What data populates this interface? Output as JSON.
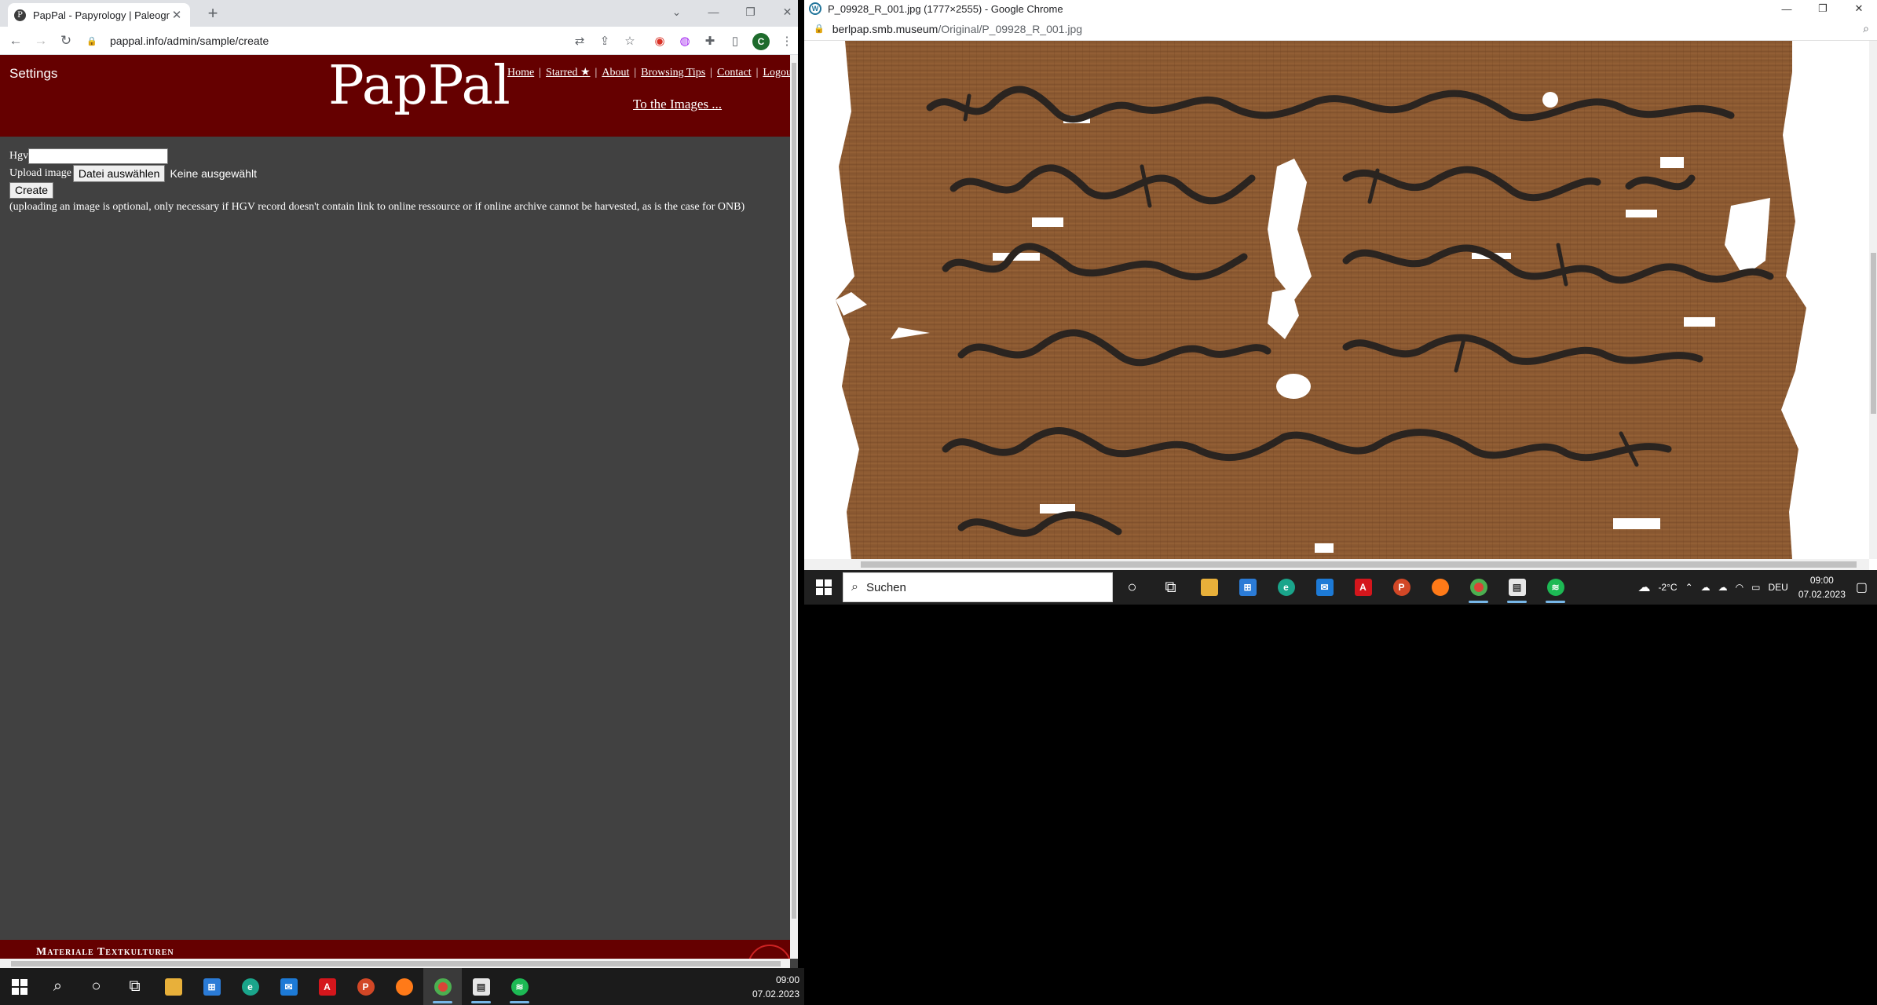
{
  "left_browser": {
    "tab_title": "PapPal - Papyrology | Paleograph",
    "new_tab": "+",
    "url": "pappal.info/admin/sample/create",
    "profile_initial": "C"
  },
  "site": {
    "settings_label": "Settings",
    "logo": "PapPal",
    "nav": {
      "home": "Home",
      "starred": "Starred ★",
      "about": "About",
      "browsing_tips": "Browsing Tips",
      "contact": "Contact",
      "logout": "Logou"
    },
    "to_images": "To the Images ...",
    "form": {
      "hgv_label": "Hgv",
      "hgv_value": "",
      "upload_label": "Upload image",
      "file_button": "Datei auswählen",
      "no_file": "Keine ausgewählt",
      "create_button": "Create",
      "note": "(uploading an image is optional, only necessary if HGV record doesn't contain link to online ressource or if online archive cannot be harvested, as is the case for ONB)"
    },
    "footer": "Materiale Textkulturen"
  },
  "right_browser": {
    "window_title": "P_09928_R_001.jpg (1777×2555) - Google Chrome",
    "url_host": "berlpap.smb.museum",
    "url_path": "/Original/P_09928_R_001.jpg"
  },
  "taskbar_right": {
    "search_placeholder": "Suchen",
    "weather": "-2°C",
    "language": "DEU",
    "time": "09:00",
    "date": "07.02.2023"
  },
  "taskbar_left": {
    "time": "09:00",
    "date": "07.02.2023"
  },
  "colors": {
    "header_red": "#650000",
    "page_bg": "#414141",
    "papyrus": "#8c5a32",
    "ink": "#2a2420"
  }
}
